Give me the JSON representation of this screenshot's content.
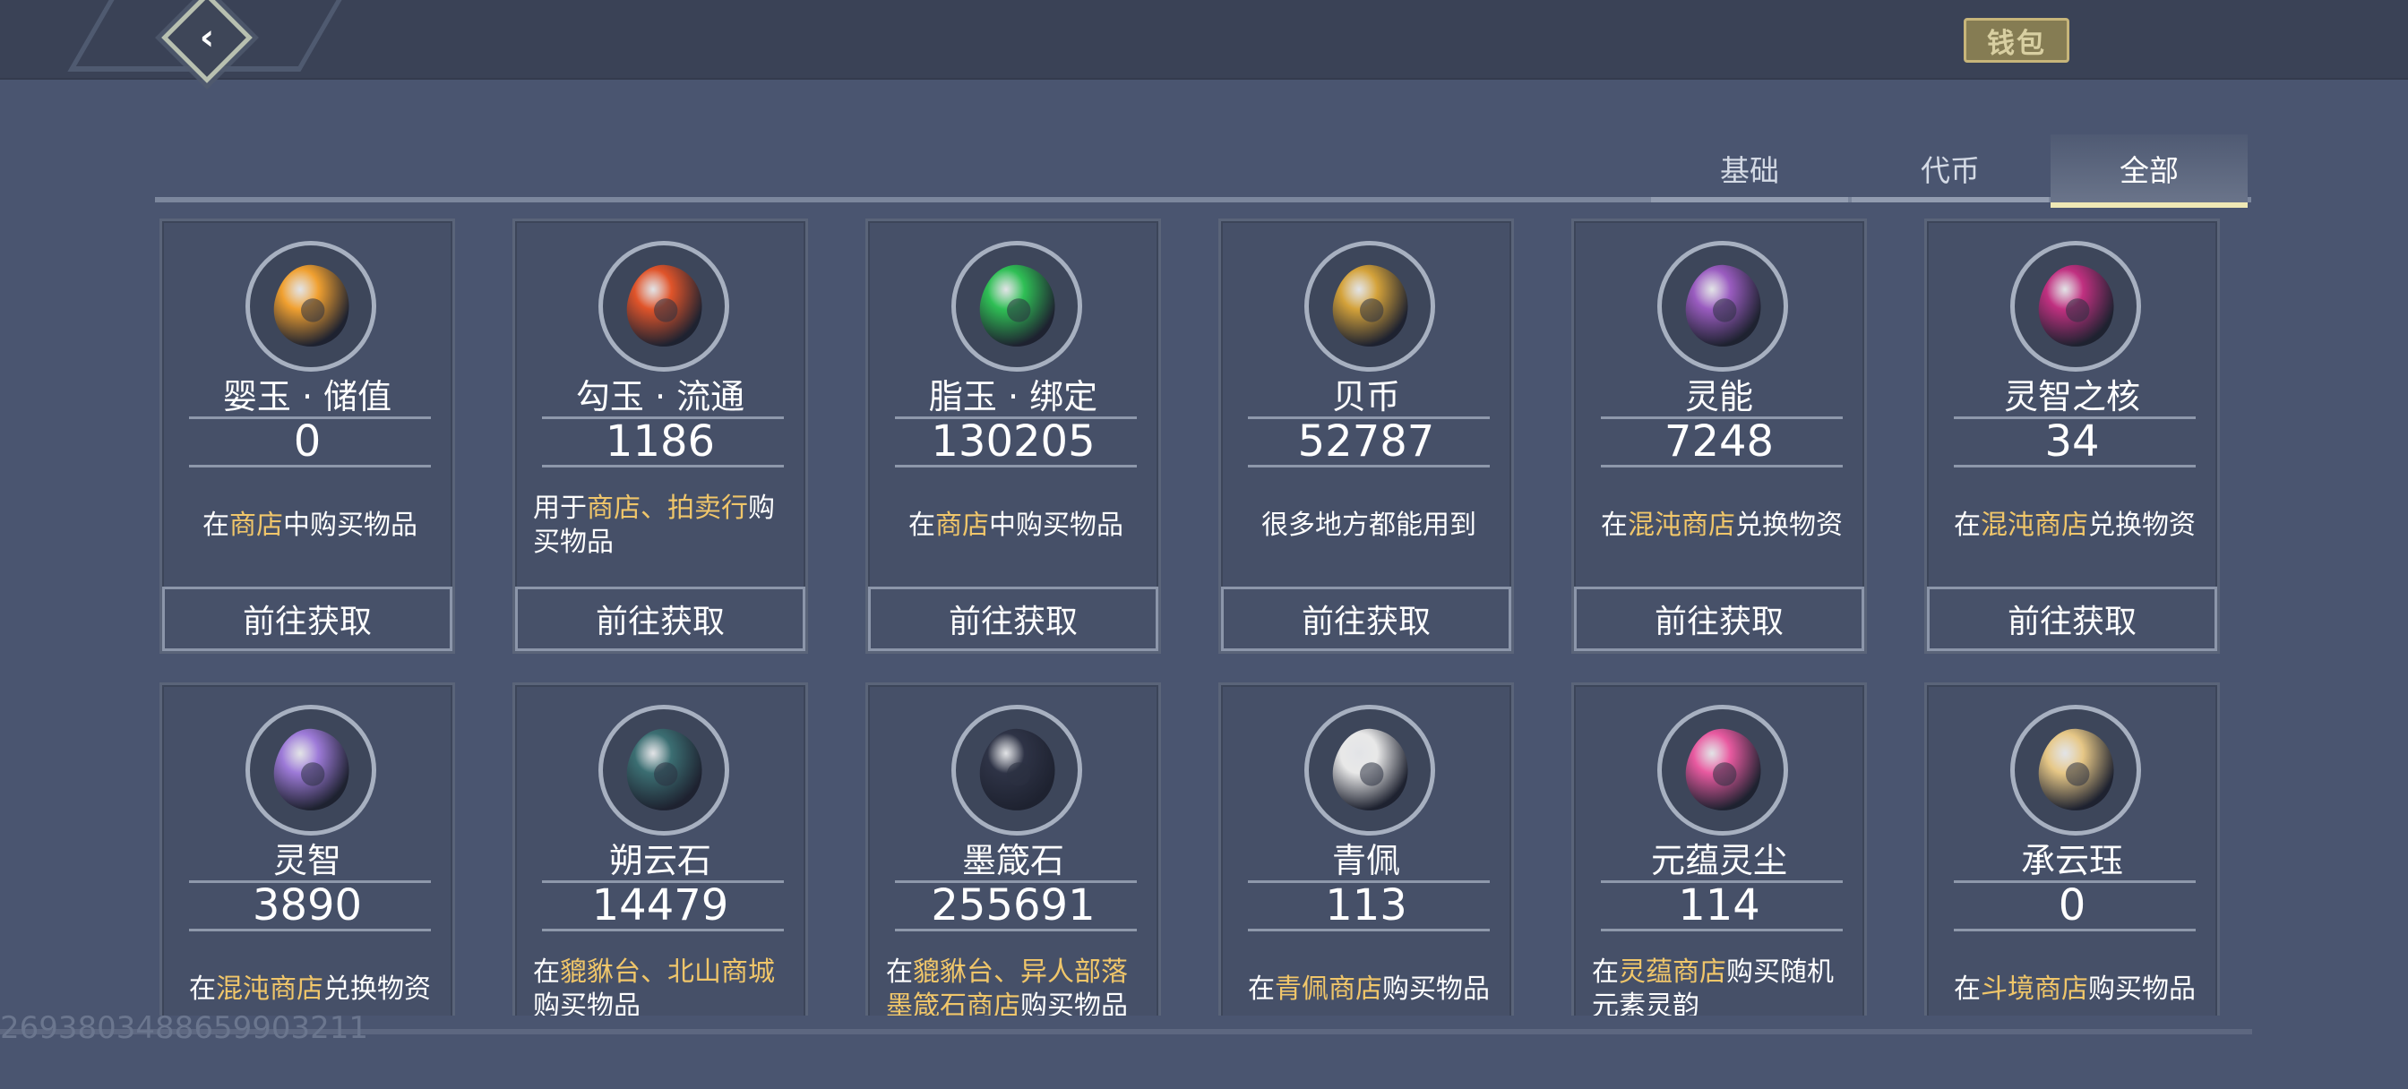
{
  "header": {
    "wallet_label": "钱包"
  },
  "tabs": [
    {
      "label": "基础",
      "active": false
    },
    {
      "label": "代币",
      "active": false
    },
    {
      "label": "全部",
      "active": true
    }
  ],
  "action_label": "前往获取",
  "currencies": [
    {
      "name": "婴玉 · 储值",
      "count": "0",
      "desc": [
        [
          "在",
          ""
        ],
        [
          "商店",
          "hl"
        ],
        [
          "中购买物品",
          ""
        ]
      ],
      "icon": "amber-jade-icon",
      "color": "#f0a030"
    },
    {
      "name": "勾玉 · 流通",
      "count": "1186",
      "desc": [
        [
          "用于",
          ""
        ],
        [
          "商店、拍卖行",
          "hl"
        ],
        [
          "购买物品",
          ""
        ]
      ],
      "icon": "red-magatama-icon",
      "color": "#e0542a"
    },
    {
      "name": "脂玉 · 绑定",
      "count": "130205",
      "desc": [
        [
          "在",
          ""
        ],
        [
          "商店",
          "hl"
        ],
        [
          "中购买物品",
          ""
        ]
      ],
      "icon": "green-jade-icon",
      "color": "#2fbf55"
    },
    {
      "name": "贝币",
      "count": "52787",
      "desc": [
        [
          "很多地方都能用到",
          ""
        ]
      ],
      "icon": "shell-coin-icon",
      "color": "#d4a23a"
    },
    {
      "name": "灵能",
      "count": "7248",
      "desc": [
        [
          "在",
          ""
        ],
        [
          "混沌商店",
          "hl"
        ],
        [
          "兑换物资",
          ""
        ]
      ],
      "icon": "spirit-orb-icon",
      "color": "#9a5cc0"
    },
    {
      "name": "灵智之核",
      "count": "34",
      "desc": [
        [
          "在",
          ""
        ],
        [
          "混沌商店",
          "hl"
        ],
        [
          "兑换物资",
          ""
        ]
      ],
      "icon": "crimson-core-icon",
      "color": "#c03080"
    },
    {
      "name": "灵智",
      "count": "3890",
      "desc": [
        [
          "在",
          ""
        ],
        [
          "混沌商店",
          "hl"
        ],
        [
          "兑换物资",
          ""
        ]
      ],
      "icon": "purple-crystal-icon",
      "color": "#9d7ad8"
    },
    {
      "name": "朔云石",
      "count": "14479",
      "desc": [
        [
          "在",
          ""
        ],
        [
          "貔貅台、北山商城",
          "hl"
        ],
        [
          "购买物品",
          ""
        ]
      ],
      "icon": "cloud-stone-icon",
      "color": "#3b6e72"
    },
    {
      "name": "墨箴石",
      "count": "255691",
      "desc": [
        [
          "在",
          ""
        ],
        [
          "貔貅台、异人部落墨箴石商店",
          "hl"
        ],
        [
          "购买物品",
          ""
        ]
      ],
      "icon": "dragon-stone-icon",
      "color": "#2e3346"
    },
    {
      "name": "青佩",
      "count": "113",
      "desc": [
        [
          "在",
          ""
        ],
        [
          "青佩商店",
          "hl"
        ],
        [
          "购买物品",
          ""
        ]
      ],
      "icon": "white-pendant-icon",
      "color": "#e8e8e8"
    },
    {
      "name": "元蕴灵尘",
      "count": "114",
      "desc": [
        [
          "在",
          ""
        ],
        [
          "灵蕴商店",
          "hl"
        ],
        [
          "购买随机元素灵韵",
          ""
        ]
      ],
      "icon": "rainbow-gem-icon",
      "color": "#e85aa0"
    },
    {
      "name": "承云珏",
      "count": "0",
      "desc": [
        [
          "在",
          ""
        ],
        [
          "斗境商店",
          "hl"
        ],
        [
          "购买物品",
          ""
        ]
      ],
      "icon": "gold-cloud-jade-icon",
      "color": "#e6c786"
    }
  ],
  "footer": {
    "uid": "2693803488659903211"
  }
}
